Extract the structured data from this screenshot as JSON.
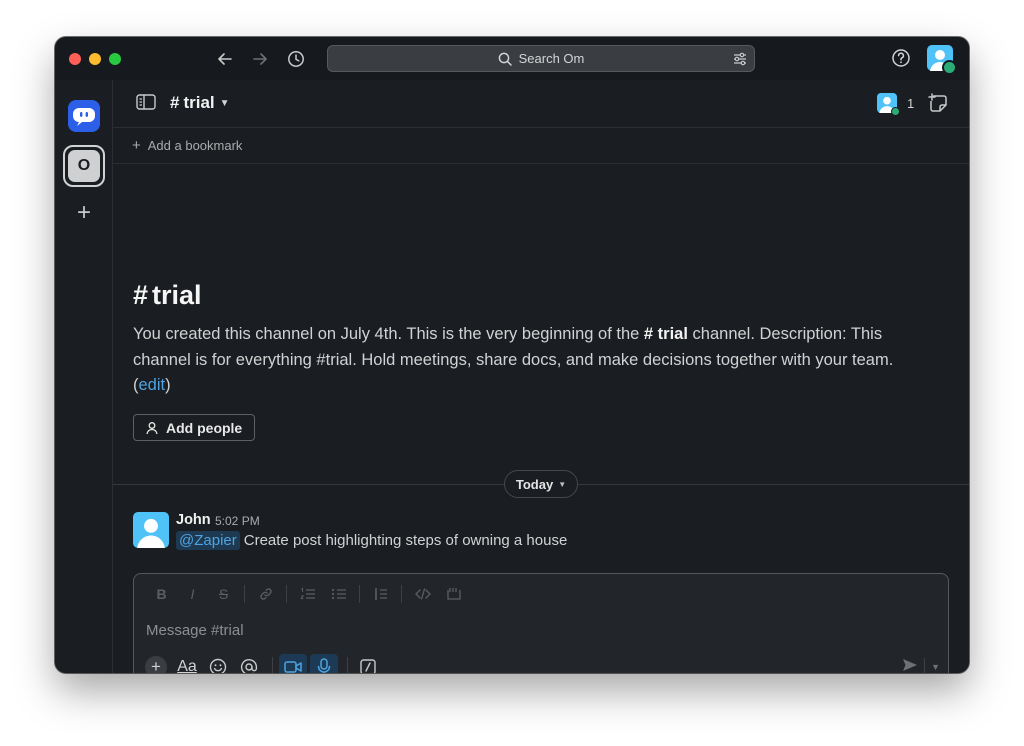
{
  "search": {
    "placeholder": "Search Om"
  },
  "workspaces": {
    "active_initial": "O"
  },
  "channel": {
    "hash": "#",
    "name": "trial",
    "member_count": "1"
  },
  "bookmarks": {
    "add_label": "Add a bookmark"
  },
  "intro": {
    "hash": "#",
    "title": "trial",
    "text_before": "You created this channel on July 4th. This is the very beginning of the ",
    "channel_ref": "# trial",
    "text_after": " channel. Description: This channel is for everything #trial. Hold meetings, share docs, and make decisions together with your team.",
    "edit_open": "(",
    "edit_link": "edit",
    "edit_close": ")",
    "add_people_label": "Add people"
  },
  "divider": {
    "label": "Today"
  },
  "messages": [
    {
      "author": "John",
      "time": "5:02 PM",
      "mention": "@Zapier",
      "text": "Create post highlighting steps of owning a house"
    }
  ],
  "composer": {
    "placeholder": "Message #trial",
    "font_button": "Aa"
  },
  "colors": {
    "accent": "#4fa3e0",
    "workspace_blue": "#2b5fe8",
    "avatar": "#4fc3f7",
    "online": "#2bac76",
    "background": "#1a1d21"
  }
}
